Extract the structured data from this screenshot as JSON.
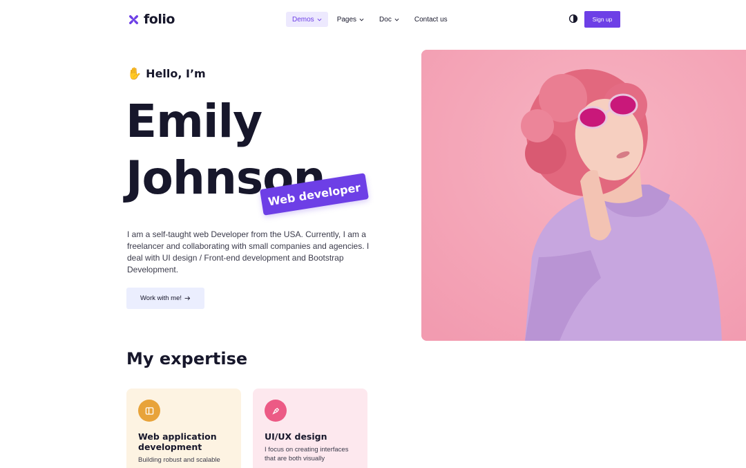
{
  "brand": {
    "name": "folio",
    "accent": "#6d3fe6"
  },
  "nav": {
    "items": [
      {
        "label": "Demos",
        "has_dropdown": true,
        "active": true
      },
      {
        "label": "Pages",
        "has_dropdown": true,
        "active": false
      },
      {
        "label": "Doc",
        "has_dropdown": true,
        "active": false
      },
      {
        "label": "Contact us",
        "has_dropdown": false,
        "active": false
      }
    ],
    "theme_icon": "contrast-icon",
    "signup_label": "Sign up"
  },
  "hero": {
    "greeting_icon": "waving-hand-icon",
    "greeting": "Hello, I’m",
    "first_name": "Emily",
    "last_name": "Johnson",
    "role": "Web developer",
    "bio": "I am a self-taught web Developer from the USA. Currently, I am a freelancer and collaborating with small companies and agencies. I deal with UI design / Front-end development and Bootstrap Development.",
    "cta_label": "Work with me!",
    "cta_icon": "arrow-right-icon",
    "image_background": "#f4a3b5"
  },
  "expertise": {
    "title": "My expertise",
    "cards": [
      {
        "title": "Web application development",
        "desc": "Building robust and scalable",
        "icon": "browser-icon",
        "color": "#e8a33a"
      },
      {
        "title": "UI/UX design",
        "desc": "I focus on creating interfaces that are both visually",
        "icon": "pen-tool-icon",
        "color": "#ec5a85"
      }
    ]
  }
}
